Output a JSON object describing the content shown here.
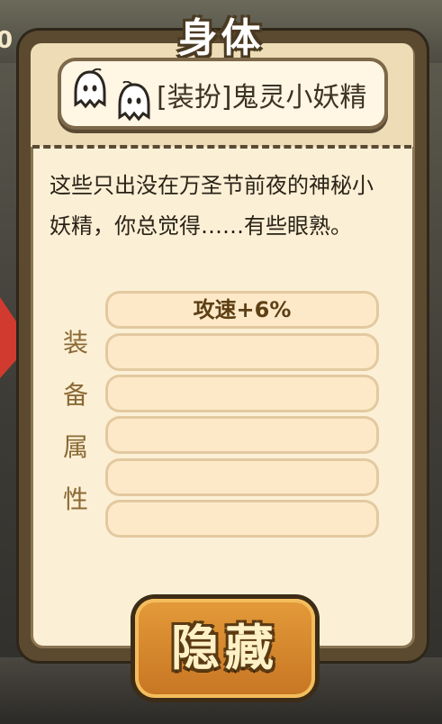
{
  "background": {
    "corner_number": "0"
  },
  "dialog": {
    "title": "身体",
    "item_name": "[装扮]鬼灵小妖精",
    "description": "这些只出没在万圣节前夜的神秘小妖精，你总觉得……有些眼熟。",
    "attributes_label": [
      "装",
      "备",
      "属",
      "性"
    ],
    "attribute_slots": [
      "攻速+6%",
      "",
      "",
      "",
      "",
      ""
    ],
    "hide_button_label": "隐藏"
  },
  "icons": {
    "item_icon": "ghost-icon"
  },
  "colors": {
    "panel": "#fbf0d6",
    "frame": "#5b4a30",
    "button": "#d9882e",
    "attr_text": "#5e3f15"
  }
}
